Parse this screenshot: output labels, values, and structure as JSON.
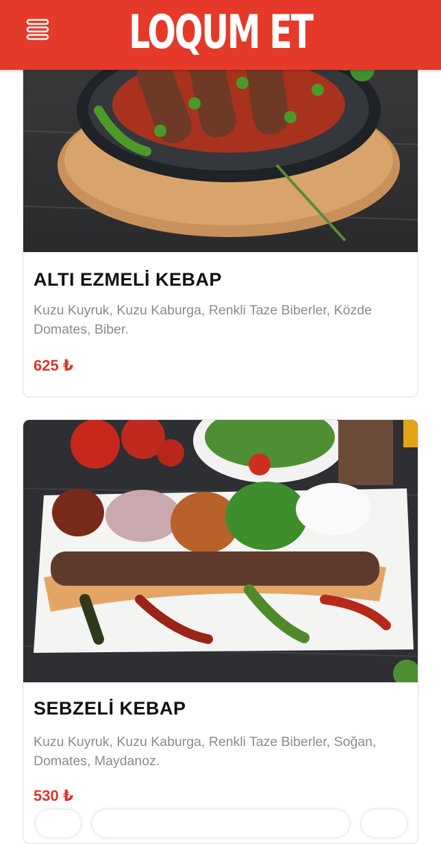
{
  "header": {
    "brand": "LOQUM ET",
    "menu_icon": "hamburger-menu-icon",
    "background": "#e53a2a"
  },
  "items": [
    {
      "title": "ALTI EZMELİ KEBAP",
      "description": "Kuzu Kuyruk, Kuzu Kaburga, Renkli Taze Biberler, Közde Domates, Biber.",
      "price": "625 ₺"
    },
    {
      "title": "SEBZELİ KEBAP",
      "description": "Kuzu Kuyruk, Kuzu Kaburga, Renkli Taze Biberler, Soğan, Domates, Maydanoz.",
      "price": "530 ₺"
    }
  ],
  "colors": {
    "accent": "#e53a2a",
    "price": "#d8362a",
    "description": "#8a8a8a"
  }
}
